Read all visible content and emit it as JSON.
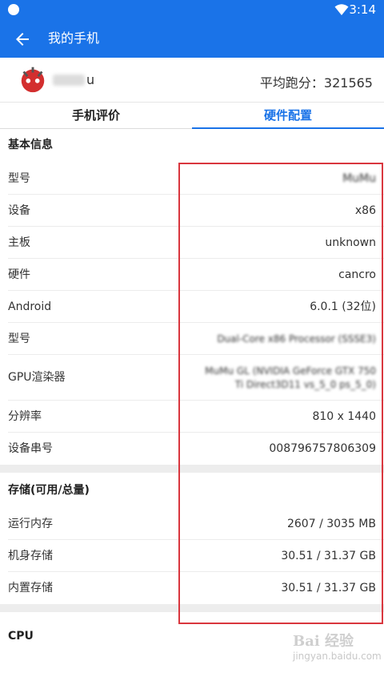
{
  "status_bar": {
    "time": "3:14"
  },
  "app_bar": {
    "title": "我的手机"
  },
  "user": {
    "name_suffix": "u",
    "score_label": "平均跑分：321565"
  },
  "tabs": [
    {
      "label": "手机评价",
      "active": false
    },
    {
      "label": "硬件配置",
      "active": true
    }
  ],
  "sections": {
    "basic": {
      "title": "基本信息",
      "rows": [
        {
          "label": "型号",
          "value": "MuMu"
        },
        {
          "label": "设备",
          "value": "x86"
        },
        {
          "label": "主板",
          "value": "unknown"
        },
        {
          "label": "硬件",
          "value": "cancro"
        },
        {
          "label": "Android",
          "value": "6.0.1 (32位)"
        },
        {
          "label": "型号",
          "value": "Dual-Core x86 Processor (SSSE3)"
        },
        {
          "label": "GPU渲染器",
          "value": "MuMu GL (NVIDIA GeForce GTX 750 Ti Direct3D11 vs_5_0 ps_5_0)"
        },
        {
          "label": "分辨率",
          "value": "810 x 1440"
        },
        {
          "label": "设备串号",
          "value": "008796757806309"
        }
      ]
    },
    "storage": {
      "title": "存储(可用/总量)",
      "rows": [
        {
          "label": "运行内存",
          "value": "2607 / 3035 MB"
        },
        {
          "label": "机身存储",
          "value": "30.51 / 31.37 GB"
        },
        {
          "label": "内置存储",
          "value": "30.51 / 31.37 GB"
        }
      ]
    },
    "cpu": {
      "title": "CPU"
    }
  },
  "watermark": {
    "text": "Bai 经验",
    "sub": "jingyan.baidu.com"
  },
  "colors": {
    "primary": "#1a73e8",
    "highlight_border": "#d9363e"
  }
}
